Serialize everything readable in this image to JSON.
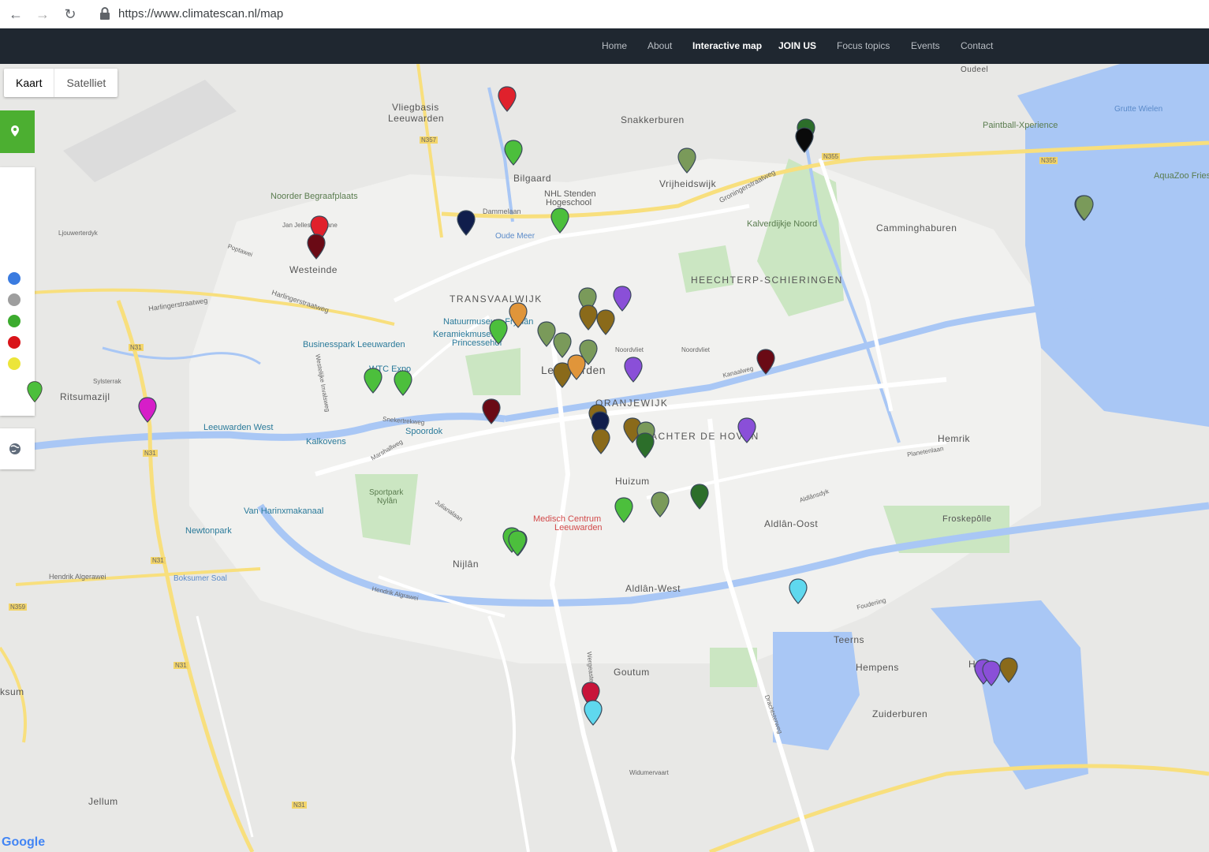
{
  "browser": {
    "url": "https://www.climatescan.nl/map"
  },
  "nav": {
    "items": [
      {
        "label": "Home",
        "active": false
      },
      {
        "label": "About",
        "active": false
      },
      {
        "label": "Interactive map",
        "active": true
      },
      {
        "label": "JOIN US",
        "active": true
      },
      {
        "label": "Focus topics",
        "active": false
      },
      {
        "label": "Events",
        "active": false
      },
      {
        "label": "Contact",
        "active": false
      }
    ]
  },
  "map_controls": {
    "map_type_options": [
      "Kaart",
      "Satelliet"
    ],
    "selected": "Kaart",
    "legend_colors": [
      "#3a7be0",
      "#9e9e9e",
      "#3cab2e",
      "#d9141a",
      "#ece53a"
    ],
    "attribution": "Google"
  },
  "map_labels": {
    "districts": [
      "TRANSVAALWIJK",
      "HEECHTERP-SCHIERINGEN",
      "ORANJEWIJK",
      "ACHTER DE HOVEN"
    ],
    "places": [
      "Vliegbasis",
      "Leeuwarden",
      "Snakkerburen",
      "Bilgaard",
      "Vrijheidswijk",
      "Camminghaburen",
      "Westeinde",
      "Leeuwarden",
      "Huizum",
      "Hemrik",
      "Aldlân-Oost",
      "Aldlân-West",
      "Nijlân",
      "Ritsumazijl",
      "Goutum",
      "Teerns",
      "Hempens",
      "Hoek",
      "Zuiderburen",
      "Jellum",
      "Froskepôlle",
      "Oudeel",
      "ksum"
    ],
    "pois": [
      "Noorder Begraafplaats",
      "Paintball-Xperience",
      "Kalverdijkje Noord",
      "NHL Stenden",
      "Hogeschool",
      "Natuurmuseum Fryslân",
      "Keramiekmuseum",
      "Princessehof",
      "Businesspark Leeuwarden",
      "WTC Expo",
      "Leeuwarden West",
      "Kalkovens",
      "Spoordok",
      "Sportpark",
      "Nylân",
      "Van Harinxmakanaal",
      "Newtonpark",
      "Medisch Centrum",
      "Leeuwarden",
      "AquaZoo Fries",
      "Boksumer Soal",
      "Grutte Wielen",
      "Oude Meer"
    ],
    "roads": [
      "N357",
      "N355",
      "N355",
      "N31",
      "N31",
      "N31",
      "N31",
      "N359",
      "N31",
      "Dammelaan",
      "Harlingerstraatweg",
      "Harlingerstraatweg",
      "Groningerstraatweg",
      "Hendrik Algerawei",
      "Hendrik Algrawei",
      "Jan Jelles Hofleane",
      "Poptawei",
      "Ljouwerterdyk",
      "Noordvliet",
      "Noordvliet",
      "Kanaalweg",
      "Planetenlaan",
      "Aldlânsdyk",
      "Julianalaan",
      "Drachtsterweg",
      "Wergeastervaart",
      "Widumervaart",
      "Fouderiing",
      "Snekertrekweg",
      "Marshallweg",
      "Westelijke Invalsweg",
      "Sylsterrak"
    ]
  },
  "markers": [
    {
      "color": "#e0212c",
      "kind": "red"
    },
    {
      "color": "#4cbf3c",
      "kind": "green"
    },
    {
      "color": "#7a9a5a",
      "kind": "olive"
    },
    {
      "color": "#2c6e2a",
      "kind": "darkgreen"
    },
    {
      "color": "#0a0a0a",
      "kind": "black"
    },
    {
      "color": "#d61ec8",
      "kind": "magenta"
    },
    {
      "color": "#e0212c",
      "kind": "red"
    },
    {
      "color": "#6a0a15",
      "kind": "darkred"
    },
    {
      "color": "#101e4c",
      "kind": "navy"
    },
    {
      "color": "#4cbf3c",
      "kind": "green"
    },
    {
      "color": "#7a9a5a",
      "kind": "olive"
    },
    {
      "color": "#8a6a1a",
      "kind": "brown"
    },
    {
      "color": "#8a6a1a",
      "kind": "brown"
    },
    {
      "color": "#8a4fd8",
      "kind": "purple"
    },
    {
      "color": "#e0953a",
      "kind": "orange"
    },
    {
      "color": "#4cbf3c",
      "kind": "green"
    },
    {
      "color": "#7a9a5a",
      "kind": "olive"
    },
    {
      "color": "#7a9a5a",
      "kind": "olive"
    },
    {
      "color": "#7a9a5a",
      "kind": "olive"
    },
    {
      "color": "#8a6a1a",
      "kind": "brown"
    },
    {
      "color": "#e0953a",
      "kind": "orange"
    },
    {
      "color": "#8a4fd8",
      "kind": "purple"
    },
    {
      "color": "#6a0a15",
      "kind": "darkred"
    },
    {
      "color": "#4cbf3c",
      "kind": "green"
    },
    {
      "color": "#4cbf3c",
      "kind": "green"
    },
    {
      "color": "#d61ec8",
      "kind": "magenta"
    },
    {
      "color": "#6a0a15",
      "kind": "darkred"
    },
    {
      "color": "#8a6a1a",
      "kind": "brown"
    },
    {
      "color": "#101e4c",
      "kind": "navy"
    },
    {
      "color": "#8a6a1a",
      "kind": "brown"
    },
    {
      "color": "#8a6a1a",
      "kind": "brown"
    },
    {
      "color": "#7a9a5a",
      "kind": "olive"
    },
    {
      "color": "#2c6e2a",
      "kind": "darkgreen"
    },
    {
      "color": "#8a4fd8",
      "kind": "purple"
    },
    {
      "color": "#4cbf3c",
      "kind": "green"
    },
    {
      "color": "#7a9a5a",
      "kind": "olive"
    },
    {
      "color": "#2c6e2a",
      "kind": "darkgreen"
    },
    {
      "color": "#4cbf3c",
      "kind": "green"
    },
    {
      "color": "#4cbf3c",
      "kind": "green"
    },
    {
      "color": "#5fd8ee",
      "kind": "cyan"
    },
    {
      "color": "#c8143a",
      "kind": "crimson"
    },
    {
      "color": "#5fd8ee",
      "kind": "cyan"
    },
    {
      "color": "#8a4fd8",
      "kind": "purple"
    },
    {
      "color": "#8a4fd8",
      "kind": "purple"
    },
    {
      "color": "#8a6a1a",
      "kind": "brown"
    },
    {
      "color": "#7a9a5a",
      "kind": "olive"
    },
    {
      "color": "#d61ec8",
      "kind": "magenta"
    },
    {
      "color": "#4cbf3c",
      "kind": "green"
    }
  ]
}
